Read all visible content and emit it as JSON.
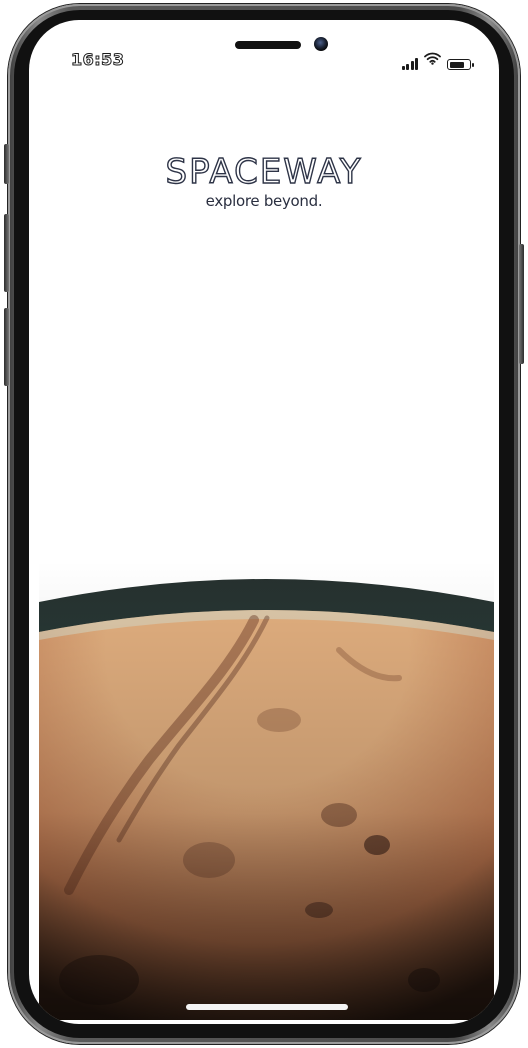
{
  "status_bar": {
    "time": "16:53",
    "icons": [
      "cellular-signal-icon",
      "wifi-icon",
      "battery-icon"
    ],
    "battery_level": 0.8
  },
  "brand": {
    "name": "SPACEWAY",
    "tagline": "explore beyond."
  },
  "hero_image": {
    "subject": "planet-mars-surface",
    "colors": {
      "atmosphere": "#2f4a45",
      "surface_light": "#e3b080",
      "surface_mid": "#c07850",
      "surface_dark": "#3a2418"
    }
  },
  "device": {
    "frame_color": "#4a4a4a",
    "home_indicator_color": "#f4f4f4"
  }
}
